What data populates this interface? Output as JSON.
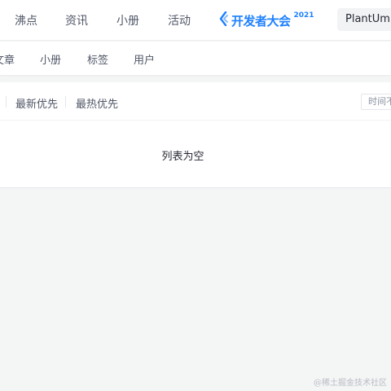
{
  "header": {
    "nav_items": [
      {
        "label": "沸点"
      },
      {
        "label": "资讯"
      },
      {
        "label": "小册"
      },
      {
        "label": "活动"
      }
    ],
    "event": {
      "label": "开发者大会",
      "year": "2021"
    },
    "search": {
      "value": "PlantUml"
    }
  },
  "sub_nav": {
    "items": [
      {
        "label": "文章"
      },
      {
        "label": "小册"
      },
      {
        "label": "标签"
      },
      {
        "label": "用户"
      }
    ]
  },
  "list": {
    "sort_options": [
      {
        "label": "最新优先"
      },
      {
        "label": "最热优先"
      }
    ],
    "time_filter": {
      "value": "时间不限"
    },
    "empty_message": "列表为空"
  },
  "watermark": "@稀土掘金技术社区",
  "colors": {
    "accent": "#1e80ff",
    "background": "#f4f5f5",
    "text": "#515767"
  }
}
